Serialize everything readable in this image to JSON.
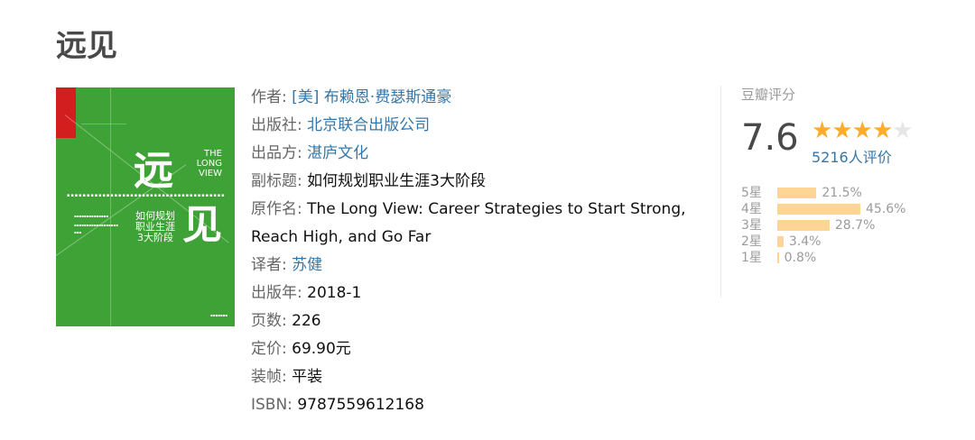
{
  "page": {
    "title": "远见"
  },
  "cover": {
    "title_chars": [
      "远",
      "见"
    ],
    "english_title_lines": [
      "THE",
      "LONG",
      "VIEW"
    ],
    "chinese_subtitle_lines": [
      "如何规划",
      "职业生涯",
      "3大阶段"
    ],
    "color": "#3fa236"
  },
  "info": {
    "author": {
      "label": "作者:",
      "value": "[美] 布赖恩·费瑟斯通豪"
    },
    "publisher": {
      "label": "出版社:",
      "value": "北京联合出版公司"
    },
    "producer": {
      "label": "出品方:",
      "value": "湛庐文化"
    },
    "subtitle": {
      "label": "副标题:",
      "value": "如何规划职业生涯3大阶段"
    },
    "original_title": {
      "label": "原作名:",
      "value": "The Long View: Career Strategies to Start Strong, Reach High, and Go Far"
    },
    "translator": {
      "label": "译者:",
      "value": "苏健"
    },
    "pub_year": {
      "label": "出版年:",
      "value": "2018-1"
    },
    "pages": {
      "label": "页数:",
      "value": "226"
    },
    "price": {
      "label": "定价:",
      "value": "69.90元"
    },
    "binding": {
      "label": "装帧:",
      "value": "平装"
    },
    "isbn": {
      "label": "ISBN:",
      "value": "9787559612168"
    }
  },
  "rating": {
    "title": "豆瓣评分",
    "score": "7.6",
    "stars_filled": 4,
    "stars_total": 5,
    "count_text": "5216人评价",
    "star_color": "#ffac2d",
    "bar_color": "#ffd596",
    "distribution": [
      {
        "label": "5星",
        "percent": 21.5,
        "percent_text": "21.5%"
      },
      {
        "label": "4星",
        "percent": 45.6,
        "percent_text": "45.6%"
      },
      {
        "label": "3星",
        "percent": 28.7,
        "percent_text": "28.7%"
      },
      {
        "label": "2星",
        "percent": 3.4,
        "percent_text": "3.4%"
      },
      {
        "label": "1星",
        "percent": 0.8,
        "percent_text": "0.8%"
      }
    ]
  }
}
